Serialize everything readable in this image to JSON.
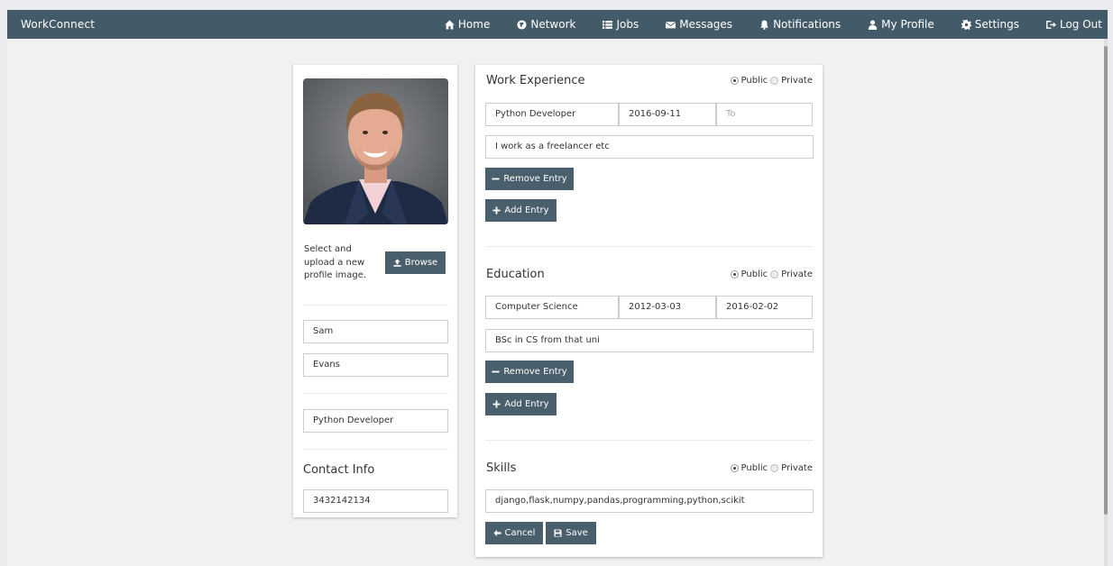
{
  "brand": "WorkConnect",
  "nav": {
    "home": "Home",
    "network": "Network",
    "jobs": "Jobs",
    "messages": "Messages",
    "notifications": "Notifications",
    "profile": "My Profile",
    "settings": "Settings",
    "logout": "Log Out"
  },
  "left": {
    "upload_text": "Select and upload a new profile image.",
    "browse": "Browse",
    "first_name": "Sam",
    "last_name": "Evans",
    "title": "Python Developer",
    "contact_heading": "Contact Info",
    "phone": "3432142134"
  },
  "visibility": {
    "public": "Public",
    "private": "Private"
  },
  "work": {
    "heading": "Work Experience",
    "position": "Python Developer",
    "from": "2016-09-11",
    "to_placeholder": "To",
    "description": "I work as a freelancer etc",
    "remove": "Remove Entry",
    "add": "Add Entry"
  },
  "education": {
    "heading": "Education",
    "field": "Computer Science",
    "from": "2012-03-03",
    "to": "2016-02-02",
    "description": "BSc in CS from that uni",
    "remove": "Remove Entry",
    "add": "Add Entry"
  },
  "skills": {
    "heading": "Skills",
    "value": "django,flask,numpy,pandas,programming,python,scikit"
  },
  "actions": {
    "cancel": "Cancel",
    "save": "Save"
  }
}
